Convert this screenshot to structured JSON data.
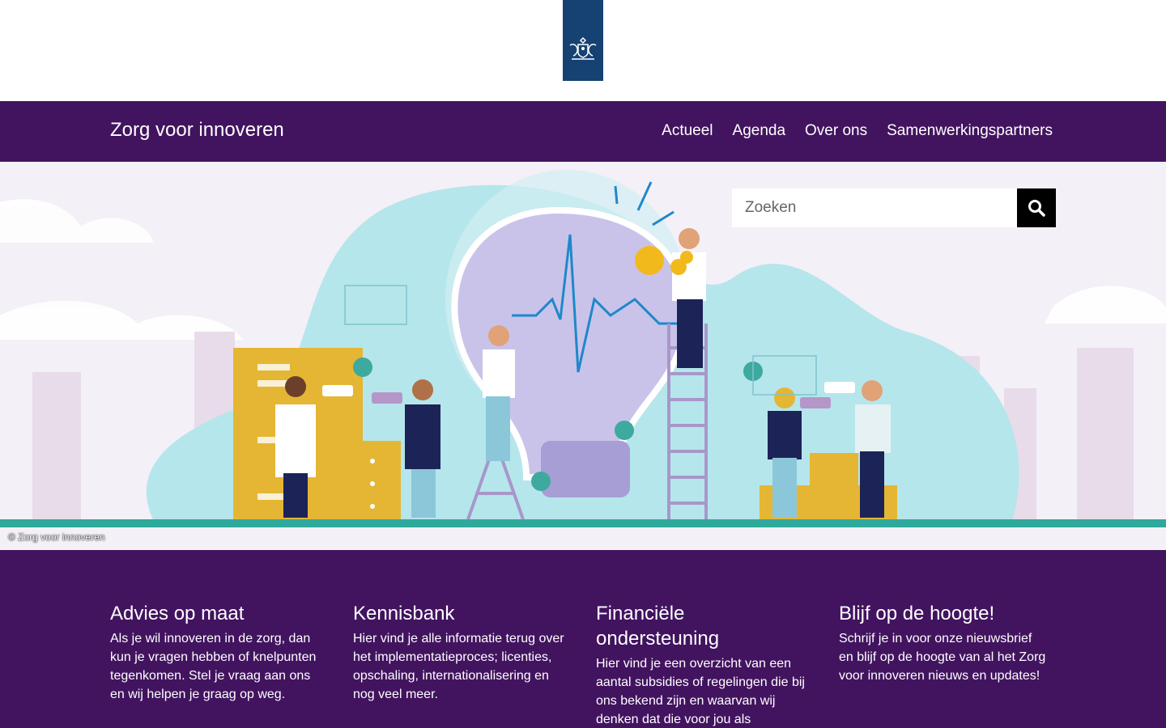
{
  "logo": {
    "name": "rijksoverheid-logo",
    "color": "#154273"
  },
  "nav": {
    "site_title": "Zorg voor innoveren",
    "links": [
      "Actueel",
      "Agenda",
      "Over ons",
      "Samenwerkingspartners"
    ],
    "background": "#42145f"
  },
  "search": {
    "placeholder": "Zoeken",
    "button_icon": "search-icon"
  },
  "hero": {
    "credit": "© Zorg voor innoveren"
  },
  "columns": [
    {
      "title": "Advies op maat",
      "text": "Als je wil innoveren in de zorg, dan kun je vragen hebben of knelpunten tegenkomen. Stel je vraag aan ons en wij helpen je graag op weg."
    },
    {
      "title": "Kennisbank",
      "text": "Hier vind je alle informatie terug over het implementatieproces; licenties, opschaling, internationalisering en nog veel meer."
    },
    {
      "title": "Financiële ondersteuning",
      "text": "Hier vind je een overzicht van een aantal subsidies of regelingen die bij ons bekend zijn en waarvan wij denken dat die voor jou als"
    },
    {
      "title": "Blijf op de hoogte!",
      "text": "Schrijf je in voor onze nieuwsbrief en blijf op de hoogte van al het Zorg voor innoveren nieuws en updates!"
    }
  ]
}
